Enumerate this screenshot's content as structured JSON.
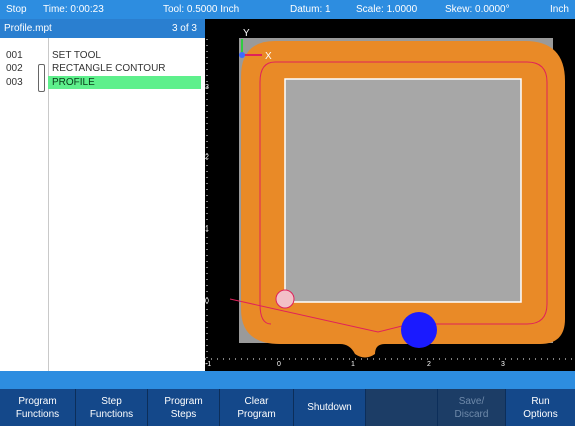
{
  "status": {
    "mode": "Stop",
    "time": "Time: 0:00:23",
    "tool": "Tool: 0.5000 Inch",
    "datum": "Datum: 1",
    "scale": "Scale: 1.0000",
    "skew": "Skew: 0.0000°",
    "units": "Inch"
  },
  "program": {
    "filename": "Profile.mpt",
    "position": "3 of 3",
    "steps": [
      {
        "num": "001",
        "label": "SET TOOL"
      },
      {
        "num": "002",
        "label": "RECTANGLE CONTOUR"
      },
      {
        "num": "003",
        "label": "PROFILE"
      }
    ]
  },
  "canvas": {
    "axis_y_label": "Y",
    "axis_x_label": "X",
    "y_ticks": [
      "3",
      "2",
      "1",
      "0"
    ],
    "x_ticks": [
      "-1",
      "0",
      "1",
      "2",
      "3"
    ],
    "colors": {
      "background": "#000000",
      "sheet": "#9a9a9a",
      "tool_path": "#e98a27",
      "contour_line": "#e0215a",
      "part": "#a7a7a7",
      "tool": "#1a1aff",
      "start_marker": "#e0215a"
    }
  },
  "softkeys": [
    {
      "label": "Program\nFunctions"
    },
    {
      "label": "Step\nFunctions"
    },
    {
      "label": "Program\nSteps"
    },
    {
      "label": "Clear\nProgram"
    },
    {
      "label": "Shutdown"
    },
    {
      "label": ""
    },
    {
      "label": "Save/\nDiscard"
    },
    {
      "label": "Run\nOptions"
    }
  ]
}
